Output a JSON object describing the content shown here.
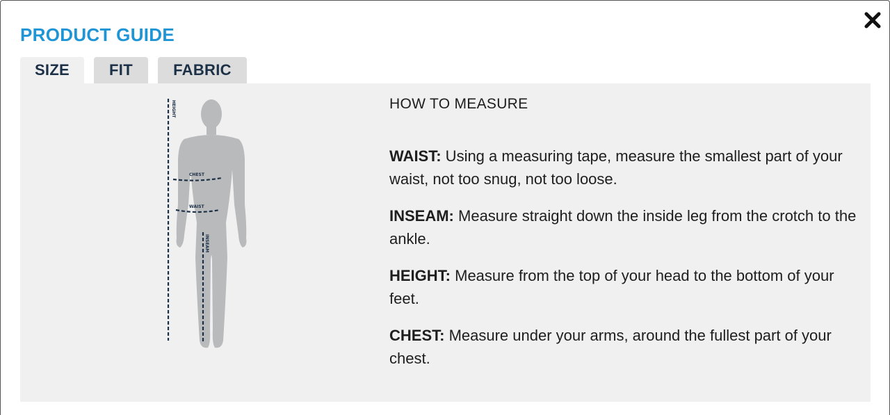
{
  "modal": {
    "title": "PRODUCT GUIDE"
  },
  "tabs": [
    {
      "label": "SIZE",
      "active": true
    },
    {
      "label": "FIT",
      "active": false
    },
    {
      "label": "FABRIC",
      "active": false
    }
  ],
  "figure": {
    "labels": {
      "height": "HEIGHT",
      "chest": "CHEST",
      "waist": "WAIST",
      "inseam": "INSEAM"
    }
  },
  "measure": {
    "heading": "HOW TO MEASURE",
    "items": [
      {
        "term": "WAIST:",
        "text": " Using a measuring tape, measure the smallest part of your waist, not too snug, not too loose."
      },
      {
        "term": "INSEAM:",
        "text": " Measure straight down the inside leg from the crotch to the ankle."
      },
      {
        "term": "HEIGHT:",
        "text": " Measure from the top of your head to the bottom of your feet."
      },
      {
        "term": "CHEST:",
        "text": " Measure under your arms, around the fullest part of your chest."
      }
    ]
  },
  "colors": {
    "title": "#1f95d6",
    "tab_text": "#1c3147",
    "tab_inactive": "#dcdcdc",
    "panel": "#f0f0f0",
    "silhouette": "#b9babc",
    "measure_line": "#1c3147"
  },
  "icons": {
    "close": "close-icon"
  }
}
